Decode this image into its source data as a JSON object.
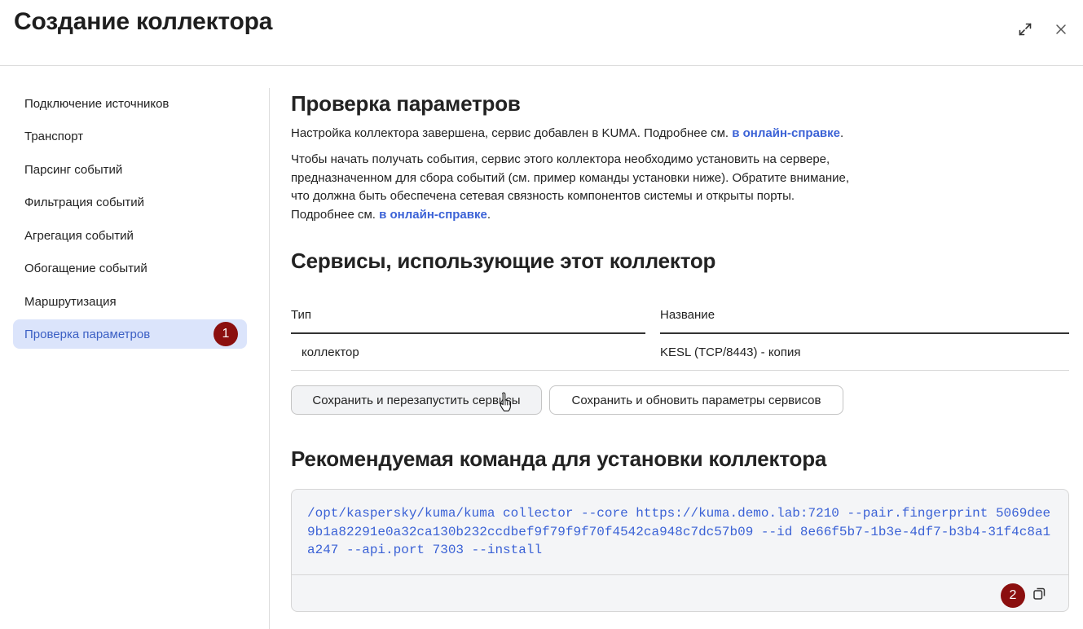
{
  "window": {
    "title": "Создание коллектора",
    "expand_icon": "expand-icon",
    "close_icon": "close-icon"
  },
  "sidebar": {
    "items": [
      {
        "label": "Подключение источников",
        "active": false
      },
      {
        "label": "Транспорт",
        "active": false
      },
      {
        "label": "Парсинг событий",
        "active": false
      },
      {
        "label": "Фильтрация событий",
        "active": false
      },
      {
        "label": "Агрегация событий",
        "active": false
      },
      {
        "label": "Обогащение событий",
        "active": false
      },
      {
        "label": "Маршрутизация",
        "active": false
      },
      {
        "label": "Проверка параметров",
        "active": true
      }
    ],
    "active_badge": "1"
  },
  "main": {
    "section1": {
      "heading": "Проверка параметров",
      "p1_text": "Настройка коллектора завершена, сервис добавлен в KUMA. Подробнее см. ",
      "p1_link": "в онлайн-справке",
      "p1_end": ".",
      "p2_line1": "Чтобы начать получать события, сервис этого коллектора необходимо установить на сервере,",
      "p2_line2": "предназначенном для сбора событий (см. пример команды установки ниже). Обратите внимание,",
      "p2_line3": "что должна быть обеспечена сетевая связность компонентов системы и открыты порты.",
      "p2_line4_text": "Подробнее см. ",
      "p2_link": "в онлайн-справке",
      "p2_end": "."
    },
    "section2": {
      "heading": "Сервисы, использующие этот коллектор",
      "table": {
        "columns": [
          "Тип",
          "Название"
        ],
        "rows": [
          [
            "коллектор",
            "KESL (TCP/8443) - копия"
          ]
        ]
      },
      "buttons": {
        "save_restart": "Сохранить и перезапустить сервисы",
        "save_update": "Сохранить и обновить параметры сервисов"
      }
    },
    "section3": {
      "heading": "Рекомендуемая команда для установки коллектора",
      "command": "/opt/kaspersky/kuma/kuma collector --core https://kuma.demo.lab:7210 --pair.fingerprint 5069dee9b1a82291e0a32ca130b232ccdbef9f79f9f70f4542ca948c7dc57b09 --id 8e66f5b7-1b3e-4df7-b3b4-31f4c8a1a247 --api.port 7303 --install",
      "copy_icon": "copy-icon",
      "copy_badge": "2"
    }
  },
  "colors": {
    "accent": "#3b62d6",
    "active_bg": "#dbe4fb",
    "badge": "#8b0f0f"
  }
}
